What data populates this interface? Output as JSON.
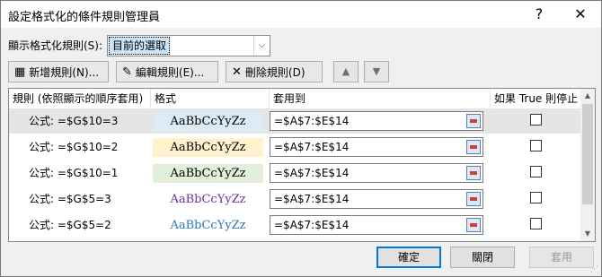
{
  "window": {
    "title": "設定格式化的條件規則管理員",
    "help": "?",
    "close": "✕"
  },
  "show_rules": {
    "label": "顯示格式化規則(S):",
    "value": "目前的選取"
  },
  "toolbar": {
    "new_rule": "新增規則(N)...",
    "edit_rule": "編輯規則(E)...",
    "delete_rule": "刪除規則(D)",
    "move_up": "▲",
    "move_down": "▼"
  },
  "table": {
    "headers": {
      "rule": "規則 (依照顯示的順序套用)",
      "format": "格式",
      "applies_to": "套用到",
      "stop_if_true": "如果 True 則停止"
    },
    "rows": [
      {
        "rule": "公式: =$G$10=3",
        "preview": "AaBbCcYyZz",
        "preview_bg": "#ddebf7",
        "preview_color": "#000000",
        "applies_to": "=$A$7:$E$14",
        "stop": false,
        "selected": true
      },
      {
        "rule": "公式: =$G$10=2",
        "preview": "AaBbCcYyZz",
        "preview_bg": "#fff2cc",
        "preview_color": "#000000",
        "applies_to": "=$A$7:$E$14",
        "stop": false,
        "selected": false
      },
      {
        "rule": "公式: =$G$10=1",
        "preview": "AaBbCcYyZz",
        "preview_bg": "#e2efda",
        "preview_color": "#000000",
        "applies_to": "=$A$7:$E$14",
        "stop": false,
        "selected": false
      },
      {
        "rule": "公式: =$G$5=3",
        "preview": "AaBbCcYyZz",
        "preview_bg": "#ffffff",
        "preview_color": "#7030a0",
        "applies_to": "=$A$7:$E$14",
        "stop": false,
        "selected": false
      },
      {
        "rule": "公式: =$G$5=2",
        "preview": "AaBbCcYyZz",
        "preview_bg": "#ffffff",
        "preview_color": "#2e75b6",
        "applies_to": "=$A$7:$E$14",
        "stop": false,
        "selected": false
      }
    ]
  },
  "footer": {
    "ok": "確定",
    "close": "關閉",
    "apply": "套用"
  }
}
